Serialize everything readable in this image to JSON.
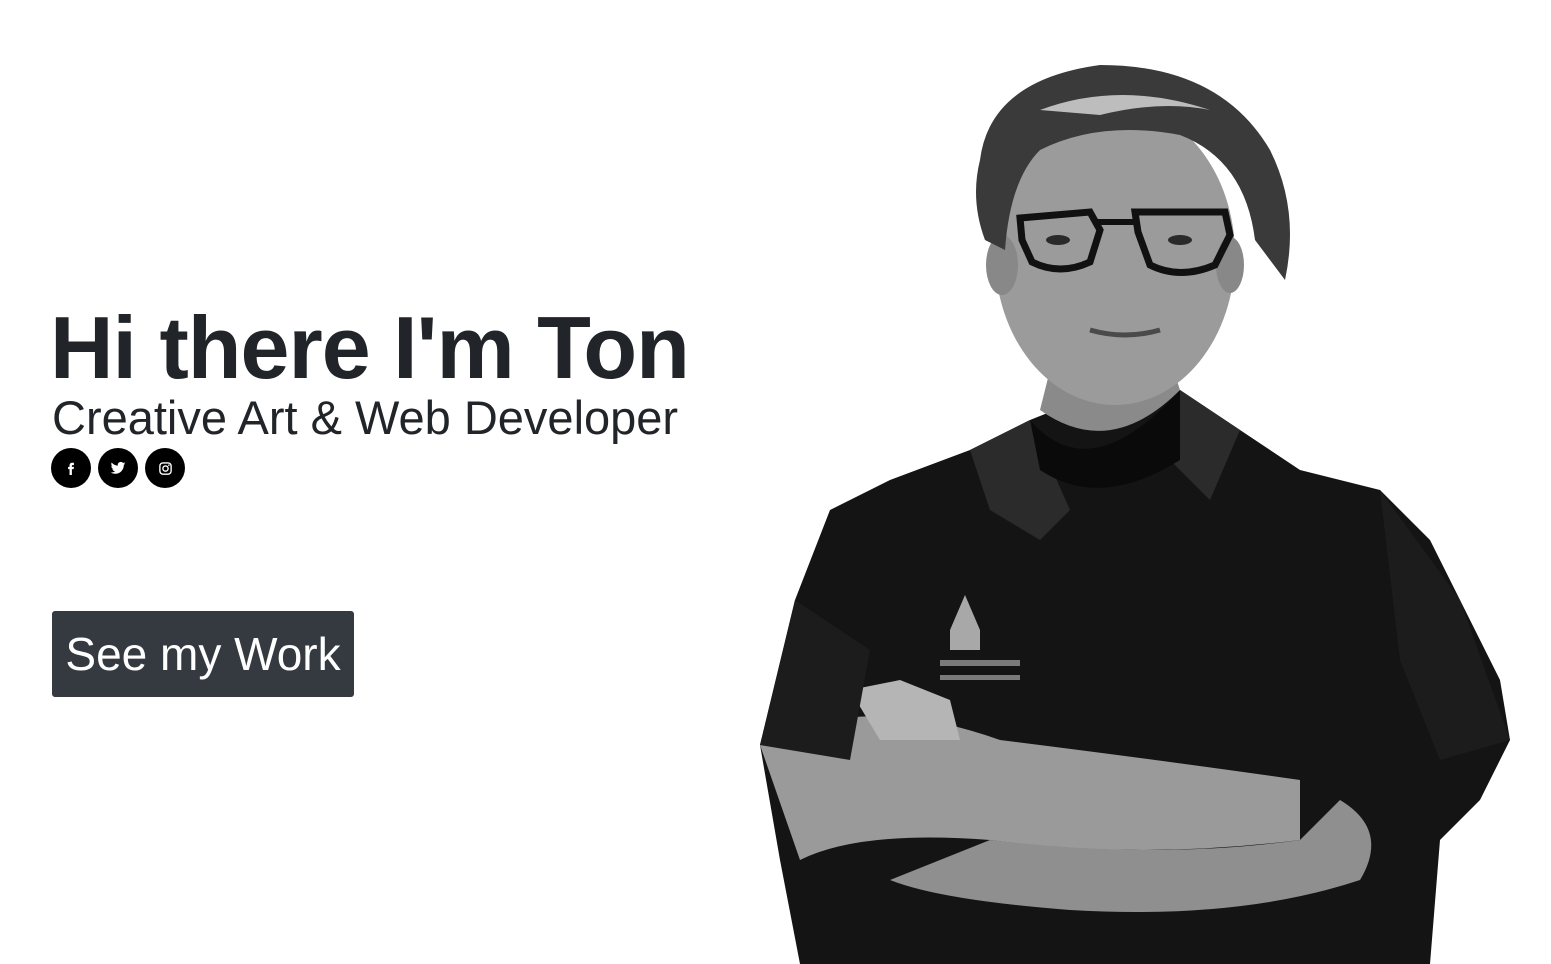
{
  "hero": {
    "headline": "Hi there I'm Ton",
    "subtitle": "Creative Art & Web Developer",
    "cta_label": "See my Work"
  },
  "social_links": [
    {
      "name": "facebook",
      "icon": "facebook-icon"
    },
    {
      "name": "twitter",
      "icon": "twitter-icon"
    },
    {
      "name": "instagram",
      "icon": "instagram-icon"
    }
  ],
  "colors": {
    "text": "#212529",
    "button_bg": "#343a40",
    "social_bg": "#000000",
    "background": "#ffffff"
  }
}
